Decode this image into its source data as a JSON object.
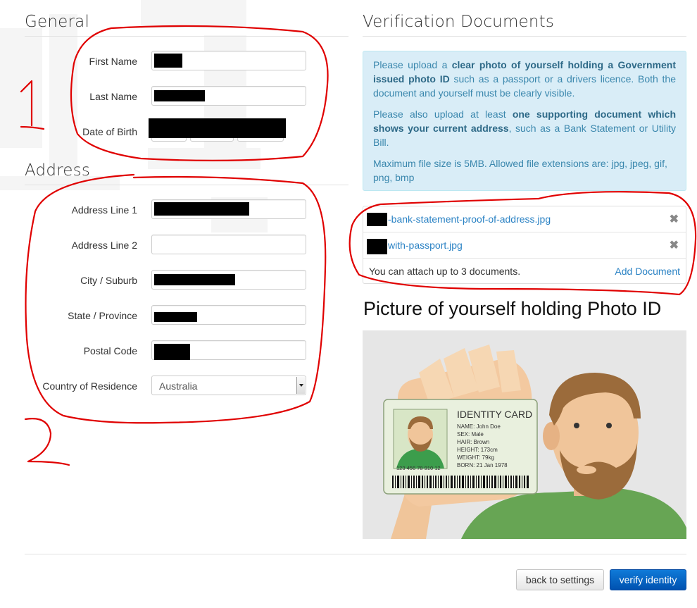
{
  "general": {
    "heading": "General",
    "first_name_label": "First Name",
    "last_name_label": "Last Name",
    "dob_label": "Date of Birth"
  },
  "address": {
    "heading": "Address",
    "line1_label": "Address Line 1",
    "line2_label": "Address Line 2",
    "city_label": "City / Suburb",
    "state_label": "State / Province",
    "postal_label": "Postal Code",
    "country_label": "Country of Residence",
    "country_value": "Australia"
  },
  "verification": {
    "heading": "Verification Documents",
    "p1_a": "Please upload a ",
    "p1_b": "clear photo of yourself holding a Government issued photo ID",
    "p1_c": " such as a passport or a drivers licence. Both the document and yourself must be clearly visible.",
    "p2_a": "Please also upload at least ",
    "p2_b": "one supporting document which shows your current address",
    "p2_c": ", such as a Bank Statement or Utility Bill.",
    "p3": "Maximum file size is 5MB. Allowed file extensions are: jpg, jpeg, gif, png, bmp",
    "documents": [
      {
        "name": "-bank-statement-proof-of-address.jpg"
      },
      {
        "name": "with-passport.jpg"
      }
    ],
    "remove_glyph": "✖",
    "attach_hint": "You can attach up to 3 documents.",
    "add_document": "Add Document"
  },
  "picture": {
    "heading": "Picture of yourself holding Photo ID",
    "card": {
      "title": "IDENTITY CARD",
      "name": "NAME: John Doe",
      "sex": "SEX: Male",
      "hair": "HAIR: Brown",
      "height": "HEIGHT: 173cm",
      "weight": "WEIGHT: 79kg",
      "born": "BORN: 21 Jan 1978",
      "number": "123 456 78 910 12"
    }
  },
  "annotations": {
    "one": "1",
    "two": "2"
  },
  "actions": {
    "back": "back to settings",
    "verify": "verify identity"
  },
  "colors": {
    "accent": "#2a82c4",
    "info_bg": "#d9edf7",
    "primary_button": "#0a64c8",
    "annotation_red": "#e00000"
  }
}
